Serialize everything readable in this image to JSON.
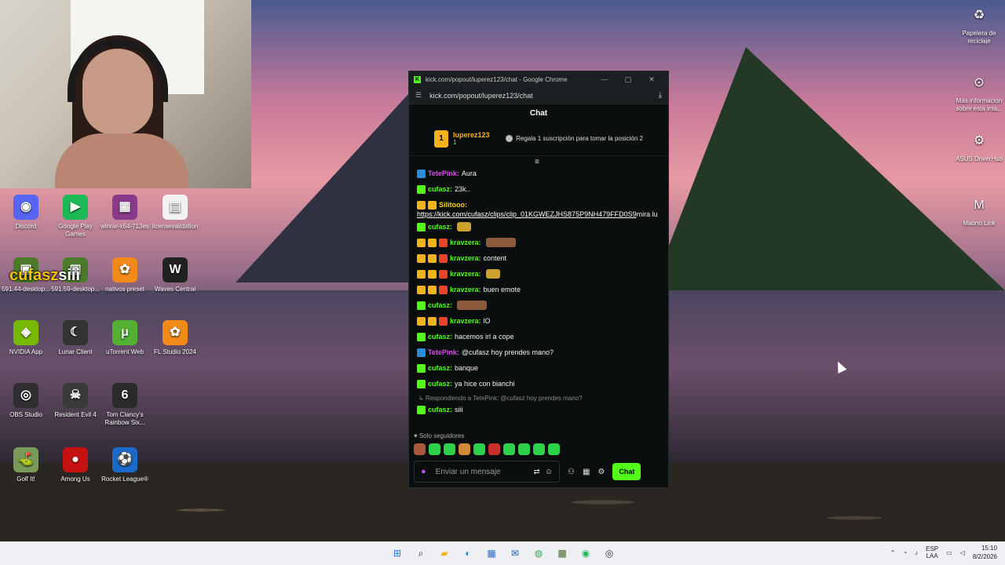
{
  "webcam": {
    "label": "webcam-feed"
  },
  "overlay": {
    "name_part": "cufasz",
    "rest_part": "siii"
  },
  "desktop_left": [
    {
      "label": "Discord",
      "icon": "discord-icon",
      "color": "#5865f2",
      "glyph": "◉"
    },
    {
      "label": "Google Play Games",
      "icon": "play-games-icon",
      "color": "#1db954",
      "glyph": "▶"
    },
    {
      "label": "winrar-x64-713es",
      "icon": "winrar-icon",
      "color": "#8a3a8a",
      "glyph": "▦"
    },
    {
      "label": "licensevalidation",
      "icon": "document-icon",
      "color": "#f2f2f2",
      "glyph": "▤"
    },
    {
      "label": "591.44-desktop...",
      "icon": "nvidia-installer-icon",
      "color": "#4a7a2a",
      "glyph": "▣"
    },
    {
      "label": "591.59-desktop...",
      "icon": "nvidia-installer-icon",
      "color": "#4a7a2a",
      "glyph": "▣"
    },
    {
      "label": "nativos preset",
      "icon": "fl-studio-icon",
      "color": "#f28a1a",
      "glyph": "✿"
    },
    {
      "label": "Waves Central",
      "icon": "waves-icon",
      "color": "#222222",
      "glyph": "W"
    },
    {
      "label": "NVIDIA App",
      "icon": "nvidia-icon",
      "color": "#76b900",
      "glyph": "◈"
    },
    {
      "label": "Lunar Client",
      "icon": "lunar-client-icon",
      "color": "#333333",
      "glyph": "☾"
    },
    {
      "label": "uTorrent Web",
      "icon": "utorrent-icon",
      "color": "#53b033",
      "glyph": "μ"
    },
    {
      "label": "FL Studio 2024",
      "icon": "fl-studio-icon",
      "color": "#f28a1a",
      "glyph": "✿"
    },
    {
      "label": "OBS Studio",
      "icon": "obs-icon",
      "color": "#302e31",
      "glyph": "◎"
    },
    {
      "label": "Resident Evil 4",
      "icon": "re4-icon",
      "color": "#3a3a3a",
      "glyph": "☠"
    },
    {
      "label": "Tom Clancy's Rainbow Six...",
      "icon": "rainbow-six-icon",
      "color": "#2a2a2a",
      "glyph": "6"
    },
    {
      "label": "Golf It!",
      "icon": "golf-it-icon",
      "color": "#7a9a5a",
      "glyph": "⛳"
    },
    {
      "label": "Among Us",
      "icon": "among-us-icon",
      "color": "#c51111",
      "glyph": "●"
    },
    {
      "label": "Rocket League®",
      "icon": "rocket-league-icon",
      "color": "#1a6ac9",
      "glyph": "⚽"
    }
  ],
  "desktop_right": [
    {
      "label": "Papelera de reciclaje",
      "icon": "recycle-bin-icon",
      "glyph": "♻"
    },
    {
      "label": "Más información sobre esta ima...",
      "icon": "info-icon",
      "glyph": "⊙"
    },
    {
      "label": "ASUS DriverHub",
      "icon": "asus-driverhub-icon",
      "glyph": "⚙"
    },
    {
      "label": "Maono Link",
      "icon": "maono-link-icon",
      "glyph": "M"
    }
  ],
  "chrome": {
    "title": "kick.com/popout/luperez123/chat - Google Chrome",
    "url": "kick.com/popout/luperez123/chat",
    "minimize": "—",
    "maximize": "▢",
    "close": "✕"
  },
  "chat": {
    "header": "Chat",
    "leader_rank": "1",
    "leader_name": "luperez123",
    "leader_count": "1",
    "gift_text": "Regala 1 suscripción para tomar la posición 2",
    "messages": [
      {
        "badges": [
          "mod"
        ],
        "user": "TetePink",
        "color": "pink",
        "text": "Aura"
      },
      {
        "badges": [
          "verified"
        ],
        "user": "cufasz",
        "color": "green",
        "text": "23k.."
      },
      {
        "badges": [
          "crown",
          "sub"
        ],
        "user": "Silitooo",
        "color": "yellow",
        "text": "",
        "link": "https://kick.com/cufasz/clips/clip_01KGWEZJHS875P9NH479FFD0S9",
        "after": " mira lu"
      },
      {
        "badges": [
          "verified"
        ],
        "user": "cufasz",
        "color": "green",
        "text": "",
        "emote": "normal"
      },
      {
        "badges": [
          "crown",
          "sub",
          "gift"
        ],
        "user": "kravzera",
        "color": "green",
        "text": "",
        "emote": "wide"
      },
      {
        "badges": [
          "crown",
          "sub",
          "gift"
        ],
        "user": "kravzera",
        "color": "green",
        "text": "content"
      },
      {
        "badges": [
          "crown",
          "sub",
          "gift"
        ],
        "user": "kravzera",
        "color": "green",
        "text": "",
        "emote": "normal"
      },
      {
        "badges": [
          "crown",
          "sub",
          "gift"
        ],
        "user": "kravzera",
        "color": "green",
        "text": "buen emote"
      },
      {
        "badges": [
          "verified"
        ],
        "user": "cufasz",
        "color": "green",
        "text": "",
        "emote": "wide"
      },
      {
        "badges": [
          "crown",
          "sub",
          "gift"
        ],
        "user": "kravzera",
        "color": "green",
        "text": "lO"
      },
      {
        "badges": [
          "verified"
        ],
        "user": "cufasz",
        "color": "green",
        "text": "hacemos irl a cope"
      },
      {
        "badges": [
          "mod"
        ],
        "user": "TetePink",
        "color": "pink",
        "text": "@cufasz hoy prendes mano?"
      },
      {
        "badges": [
          "verified"
        ],
        "user": "cufasz",
        "color": "green",
        "text": "banque"
      },
      {
        "badges": [
          "verified"
        ],
        "user": "cufasz",
        "color": "green",
        "text": "ya hice con bianchi"
      },
      {
        "badges": [
          "verified"
        ],
        "user": "cufasz",
        "color": "green",
        "text": "siii",
        "reply": "Respondiendo a TetePink: @cufasz hoy prendes mano?"
      }
    ],
    "follow_only": "♥ Solo seguidores",
    "input_placeholder": "Enviar un mensaje",
    "send_label": "Chat"
  },
  "taskbar": {
    "apps": [
      {
        "icon": "windows-start-icon",
        "glyph": "⊞",
        "color": "#1a73e8"
      },
      {
        "icon": "search-icon",
        "glyph": "⌕",
        "color": "#222222"
      },
      {
        "icon": "file-explorer-icon",
        "glyph": "▰",
        "color": "#f2b31b"
      },
      {
        "icon": "edge-icon",
        "glyph": "◐",
        "color": "#1a8ad6"
      },
      {
        "icon": "store-icon",
        "glyph": "▦",
        "color": "#2a6ac9"
      },
      {
        "icon": "outlook-icon",
        "glyph": "✉",
        "color": "#1a5ab9"
      },
      {
        "icon": "chrome-icon",
        "glyph": "◍",
        "color": "#34a853"
      },
      {
        "icon": "minecraft-icon",
        "glyph": "▩",
        "color": "#4a6a2a"
      },
      {
        "icon": "spotify-icon",
        "glyph": "◉",
        "color": "#1db954"
      },
      {
        "icon": "obs-taskbar-icon",
        "glyph": "◎",
        "color": "#302e31"
      }
    ],
    "lang_top": "ESP",
    "lang_bottom": "LAA",
    "time": "15:10",
    "date": "8/2/2026"
  }
}
